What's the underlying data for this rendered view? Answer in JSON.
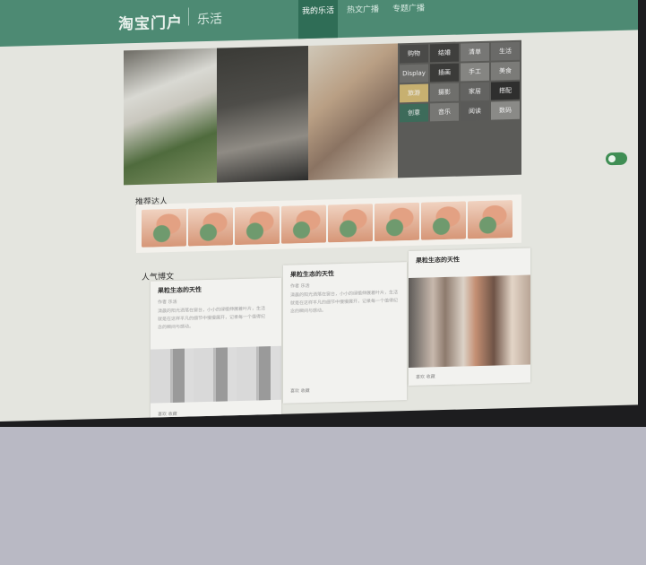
{
  "site": {
    "logo": "淘宝门户",
    "sub_logo": "乐活"
  },
  "nav": {
    "items": [
      {
        "label": "我的乐活"
      },
      {
        "label": "热文广播"
      },
      {
        "label": "专题广播"
      }
    ]
  },
  "hero": {
    "tiles": [
      {
        "label": "购物"
      },
      {
        "label": "结婚"
      },
      {
        "label": "清单"
      },
      {
        "label": "生活"
      },
      {
        "label": "Display"
      },
      {
        "label": "插画"
      },
      {
        "label": "手工"
      },
      {
        "label": "美食"
      },
      {
        "label": "旅游"
      },
      {
        "label": "摄影"
      },
      {
        "label": "家居"
      },
      {
        "label": "搭配"
      },
      {
        "label": "创意"
      },
      {
        "label": "音乐"
      },
      {
        "label": "阅读"
      },
      {
        "label": "数码"
      }
    ]
  },
  "sections": {
    "recommended_title": "推荐达人",
    "popular_title": "人气博文"
  },
  "cards": [
    {
      "title": "果粒生态的天性",
      "meta": "作者 乐活",
      "text": "清晨的阳光洒落在窗台，小小的绿植伸展着叶片，生活就是在这样平凡的细节中慢慢展开，记录每一个值得纪念的瞬间与感动。",
      "foot": "喜欢 收藏"
    },
    {
      "title": "果粒生态的天性",
      "meta": "作者 乐活",
      "text": "清晨的阳光洒落在窗台，小小的绿植伸展着叶片，生活就是在这样平凡的细节中慢慢展开，记录每一个值得纪念的瞬间与感动。",
      "foot": "喜欢 收藏"
    },
    {
      "title": "果粒生态的天性",
      "meta": "",
      "text": "",
      "foot": "喜欢 收藏"
    }
  ]
}
